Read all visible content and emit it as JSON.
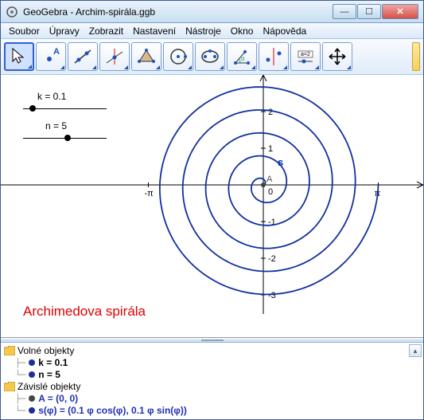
{
  "window": {
    "title": "GeoGebra - Archim-spirála.ggb"
  },
  "menu": {
    "soubor": "Soubor",
    "upravy": "Úpravy",
    "zobrazit": "Zobrazit",
    "nastaveni": "Nastavení",
    "nastroje": "Nástroje",
    "okno": "Okno",
    "napoveda": "Nápověda"
  },
  "sliders": {
    "k": {
      "label": "k = 0.1",
      "pos": 8
    },
    "n": {
      "label": "n = 5",
      "pos": 52
    }
  },
  "plot": {
    "title": "Archimedova spirála",
    "curve_label": "s",
    "origin_label": "A",
    "origin_value": "0",
    "ticks": {
      "neg_pi": "-π",
      "pi": "π",
      "y1": "1",
      "y2": "2",
      "ym1": "-1",
      "ym2": "-2",
      "ym3": "-3"
    }
  },
  "algebra": {
    "free_label": "Volné objekty",
    "dep_label": "Závislé objekty",
    "k": "k = 0.1",
    "n": "n = 5",
    "A": "A = (0, 0)",
    "s": "s(φ) = (0.1 φ cos(φ), 0.1 φ sin(φ))"
  },
  "toolbar": {
    "input_sample": "a=2"
  },
  "colors": {
    "spiral": "#1030a0",
    "title": "#e00000",
    "dep": "#2030b0",
    "free_bullet": "#1a2f99"
  },
  "chart_data": {
    "type": "line",
    "title": "Archimedova spirála",
    "curve": "parametric: x(φ)=0.1·φ·cos(φ), y(φ)=0.1·φ·sin(φ)",
    "params": {
      "k": 0.1,
      "n": 5
    },
    "phi_range": [
      0,
      31.4159
    ],
    "x_ticks": [
      -3.1416,
      3.1416
    ],
    "x_tick_labels": [
      "-π",
      "π"
    ],
    "y_ticks": [
      -3,
      -2,
      -1,
      1,
      2
    ],
    "origin": [
      0,
      0
    ],
    "xlim": [
      -4.5,
      4.5
    ],
    "ylim": [
      -3.4,
      2.6
    ]
  }
}
